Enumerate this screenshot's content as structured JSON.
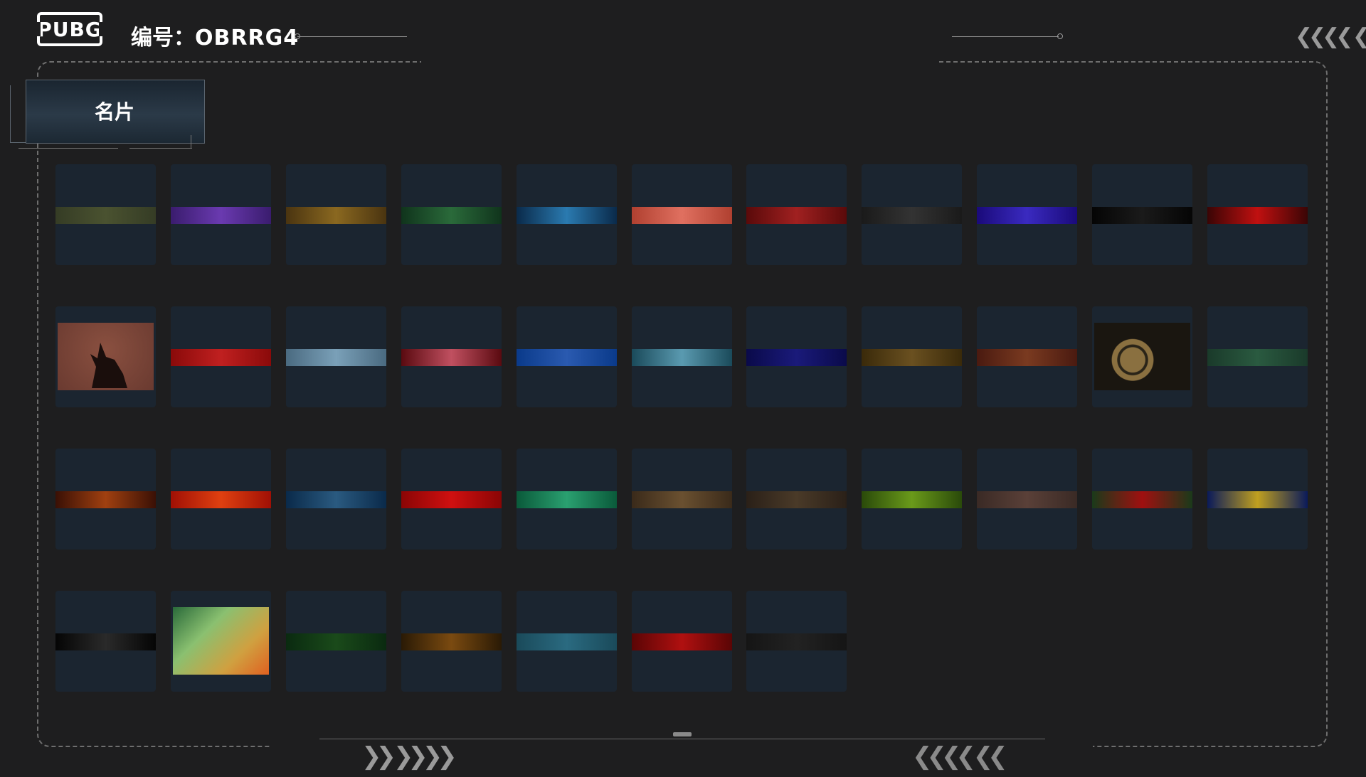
{
  "header": {
    "logo_text": "PUBG",
    "id_prefix": "编号：",
    "id_code": "OBRRG4",
    "top_right_chevrons": "❮❮❮❮ ❮"
  },
  "tab": {
    "label": "名片"
  },
  "footer": {
    "left_chevrons": "❯❯ ❯❯❯❯",
    "right_chevrons": "❮❮❮❮ ❮❮"
  },
  "cards": [
    {
      "row": 0,
      "col": 0,
      "colors": [
        "#353c25",
        "#4a5230"
      ],
      "kind": "strip"
    },
    {
      "row": 0,
      "col": 1,
      "colors": [
        "#3a1c6e",
        "#6a3ab0"
      ],
      "kind": "strip"
    },
    {
      "row": 0,
      "col": 2,
      "colors": [
        "#4a3410",
        "#8a6820"
      ],
      "kind": "strip"
    },
    {
      "row": 0,
      "col": 3,
      "colors": [
        "#10341c",
        "#2a6a3a"
      ],
      "kind": "strip"
    },
    {
      "row": 0,
      "col": 4,
      "colors": [
        "#0a2a4a",
        "#2a7ab0"
      ],
      "kind": "strip"
    },
    {
      "row": 0,
      "col": 5,
      "colors": [
        "#b04030",
        "#e07060"
      ],
      "kind": "strip"
    },
    {
      "row": 0,
      "col": 6,
      "colors": [
        "#5a0a0a",
        "#a02020"
      ],
      "kind": "strip"
    },
    {
      "row": 0,
      "col": 7,
      "colors": [
        "#1a1a1a",
        "#333333"
      ],
      "kind": "strip"
    },
    {
      "row": 0,
      "col": 8,
      "colors": [
        "#1a0a7a",
        "#3a2ac0"
      ],
      "kind": "strip"
    },
    {
      "row": 0,
      "col": 9,
      "colors": [
        "#050505",
        "#1a1a1a"
      ],
      "kind": "strip"
    },
    {
      "row": 0,
      "col": 10,
      "colors": [
        "#3a0505",
        "#c01010"
      ],
      "kind": "strip"
    },
    {
      "row": 1,
      "col": 0,
      "colors": [
        "#6a3a30",
        "#8a5040"
      ],
      "kind": "wolf"
    },
    {
      "row": 1,
      "col": 1,
      "colors": [
        "#8a0a0a",
        "#c02020"
      ],
      "kind": "strip"
    },
    {
      "row": 1,
      "col": 2,
      "colors": [
        "#4a6a80",
        "#7aa0b8"
      ],
      "kind": "strip"
    },
    {
      "row": 1,
      "col": 3,
      "colors": [
        "#5a0a10",
        "#c05060"
      ],
      "kind": "strip"
    },
    {
      "row": 1,
      "col": 4,
      "colors": [
        "#0a3a8a",
        "#2a5ab0"
      ],
      "kind": "strip"
    },
    {
      "row": 1,
      "col": 5,
      "colors": [
        "#1a4a5a",
        "#5a9ab0"
      ],
      "kind": "strip"
    },
    {
      "row": 1,
      "col": 6,
      "colors": [
        "#0a0a4a",
        "#1a1a7a"
      ],
      "kind": "strip"
    },
    {
      "row": 1,
      "col": 7,
      "colors": [
        "#3a2a0a",
        "#6a5020"
      ],
      "kind": "strip"
    },
    {
      "row": 1,
      "col": 8,
      "colors": [
        "#4a1a10",
        "#7a3a20"
      ],
      "kind": "strip"
    },
    {
      "row": 1,
      "col": 9,
      "colors": [
        "#3a3020",
        "#8a7040"
      ],
      "kind": "gears"
    },
    {
      "row": 1,
      "col": 10,
      "colors": [
        "#1a3a2a",
        "#2a5a40"
      ],
      "kind": "strip"
    },
    {
      "row": 2,
      "col": 0,
      "colors": [
        "#3a1005",
        "#a04010"
      ],
      "kind": "strip"
    },
    {
      "row": 2,
      "col": 1,
      "colors": [
        "#a01005",
        "#e04010"
      ],
      "kind": "strip"
    },
    {
      "row": 2,
      "col": 2,
      "colors": [
        "#0a2a4a",
        "#2a5a80"
      ],
      "kind": "strip"
    },
    {
      "row": 2,
      "col": 3,
      "colors": [
        "#8a0505",
        "#d01010"
      ],
      "kind": "strip"
    },
    {
      "row": 2,
      "col": 4,
      "colors": [
        "#0a5a3a",
        "#2aa070"
      ],
      "kind": "strip"
    },
    {
      "row": 2,
      "col": 5,
      "colors": [
        "#3a2a1a",
        "#6a5030"
      ],
      "kind": "strip"
    },
    {
      "row": 2,
      "col": 6,
      "colors": [
        "#2a2018",
        "#4a3a28"
      ],
      "kind": "strip"
    },
    {
      "row": 2,
      "col": 7,
      "colors": [
        "#2a4a0a",
        "#6a9a1a"
      ],
      "kind": "strip"
    },
    {
      "row": 2,
      "col": 8,
      "colors": [
        "#3a2a25",
        "#5a4038"
      ],
      "kind": "strip"
    },
    {
      "row": 2,
      "col": 9,
      "colors": [
        "#1a3a1a",
        "#a01010"
      ],
      "kind": "strip"
    },
    {
      "row": 2,
      "col": 10,
      "colors": [
        "#0a1a5a",
        "#c0a020"
      ],
      "kind": "strip"
    },
    {
      "row": 3,
      "col": 0,
      "colors": [
        "#050505",
        "#2a2a2a"
      ],
      "kind": "strip"
    },
    {
      "row": 3,
      "col": 1,
      "colors": [
        "#2a6a3a",
        "#d0a040"
      ],
      "kind": "xmas"
    },
    {
      "row": 3,
      "col": 2,
      "colors": [
        "#0a2a10",
        "#1a4a1a"
      ],
      "kind": "strip"
    },
    {
      "row": 3,
      "col": 3,
      "colors": [
        "#2a1a05",
        "#7a4a10"
      ],
      "kind": "strip"
    },
    {
      "row": 3,
      "col": 4,
      "colors": [
        "#1a4a5a",
        "#2a6a80"
      ],
      "kind": "strip"
    },
    {
      "row": 3,
      "col": 5,
      "colors": [
        "#5a0505",
        "#b01010"
      ],
      "kind": "strip"
    },
    {
      "row": 3,
      "col": 6,
      "colors": [
        "#151515",
        "#222222"
      ],
      "kind": "strip"
    }
  ]
}
